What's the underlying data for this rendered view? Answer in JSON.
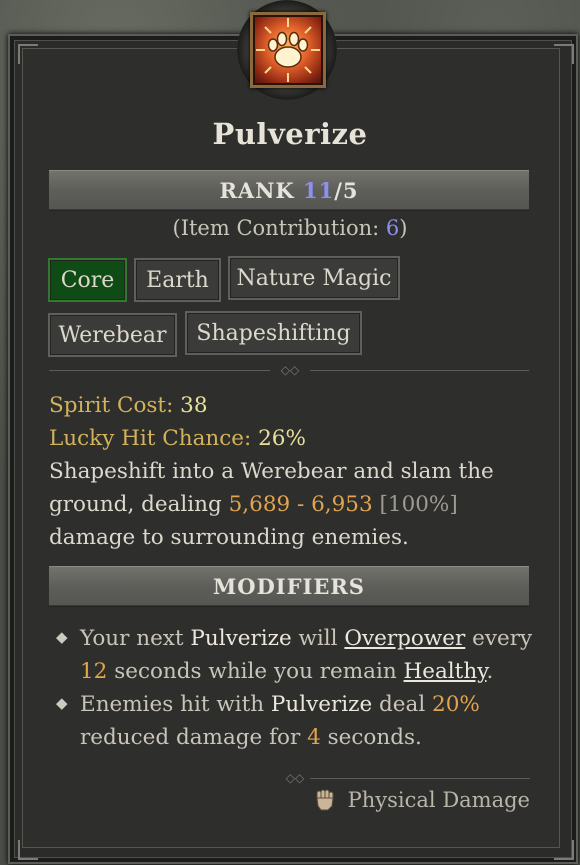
{
  "skill": {
    "name": "Pulverize",
    "icon": "bear-paw-icon",
    "rank_label": "RANK",
    "rank_current": "11",
    "rank_sep": "/",
    "rank_max": "5",
    "contrib_prefix": "(Item Contribution: ",
    "contrib_value": "6",
    "contrib_suffix": ")",
    "tags": [
      "Core",
      "Earth",
      "Nature Magic",
      "Werebear",
      "Shapeshifting"
    ],
    "spirit_label": "Spirit Cost: ",
    "spirit_value": "38",
    "lucky_label": "Lucky Hit Chance: ",
    "lucky_value": "26%",
    "desc_line1": "Shapeshift into a Werebear and slam the",
    "desc_line2_a": "ground, dealing ",
    "desc_damage": "5,689 - 6,953",
    "desc_percent": " [100%]",
    "desc_line3": "damage to surrounding enemies.",
    "modifiers_label": "MODIFIERS",
    "mod1": {
      "a": "Your next ",
      "b": "Pulverize",
      "c": " will ",
      "d": "Overpower",
      "e": " every",
      "f": "12",
      "g": " seconds while you remain ",
      "h": "Healthy",
      "i": "."
    },
    "mod2": {
      "a": "Enemies hit with ",
      "b": "Pulverize",
      "c": " deal ",
      "d": "20%",
      "e": "reduced damage for ",
      "f": "4",
      "g": " seconds."
    },
    "damage_type": "Physical Damage",
    "damage_type_icon": "fist-icon"
  },
  "colors": {
    "rank_accent": "#8f8ff0",
    "core_tag": "#0f4b14",
    "stat_value": "#e8e09a",
    "damage_value": "#e2a44e"
  }
}
